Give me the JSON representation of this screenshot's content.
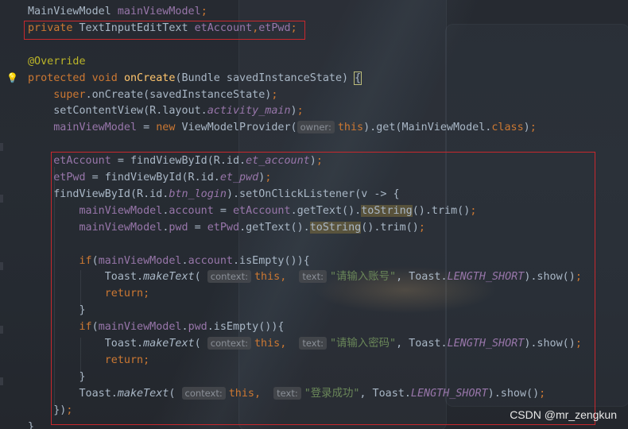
{
  "code_lines": [
    [
      {
        "t": "MainViewModel ",
        "c": "plain"
      },
      {
        "t": "mainViewModel",
        "c": "fld"
      },
      {
        "t": ";",
        "c": "kw"
      }
    ],
    [
      {
        "t": "private ",
        "c": "kw"
      },
      {
        "t": "TextInputEditText ",
        "c": "plain"
      },
      {
        "t": "etAccount",
        "c": "fld"
      },
      {
        "t": ",",
        "c": "kw"
      },
      {
        "t": "etPwd",
        "c": "fld"
      },
      {
        "t": ";",
        "c": "kw"
      }
    ],
    [],
    [
      {
        "t": "@Override",
        "c": "ann"
      }
    ],
    [
      {
        "t": "protected void ",
        "c": "kw"
      },
      {
        "t": "onCreate",
        "c": "fn"
      },
      {
        "t": "(Bundle savedInstanceState) ",
        "c": "plain"
      },
      {
        "t": "{",
        "c": "plain brace-hl"
      }
    ],
    [
      {
        "t": "    "
      },
      {
        "t": "super",
        "c": "kw"
      },
      {
        "t": ".onCreate(savedInstanceState)",
        "c": "plain"
      },
      {
        "t": ";",
        "c": "kw"
      }
    ],
    [
      {
        "t": "    "
      },
      {
        "t": "setContentView(R.layout.",
        "c": "plain"
      },
      {
        "t": "activity_main",
        "c": "italfld"
      },
      {
        "t": ")",
        "c": "plain"
      },
      {
        "t": ";",
        "c": "kw"
      }
    ],
    [
      {
        "t": "    "
      },
      {
        "t": "mainViewModel",
        "c": "fld"
      },
      {
        "t": " = ",
        "c": "plain"
      },
      {
        "t": "new ",
        "c": "kw"
      },
      {
        "t": "ViewModelProvider(",
        "c": "plain"
      },
      {
        "t": "owner:",
        "c": "hint"
      },
      {
        "t": "this",
        "c": "kw"
      },
      {
        "t": ").get(MainViewModel.",
        "c": "plain"
      },
      {
        "t": "class",
        "c": "kw"
      },
      {
        "t": ")",
        "c": "plain"
      },
      {
        "t": ";",
        "c": "kw"
      }
    ],
    [],
    [
      {
        "t": "    "
      },
      {
        "t": "etAccount",
        "c": "fld"
      },
      {
        "t": " = findViewById(R.id.",
        "c": "plain"
      },
      {
        "t": "et_account",
        "c": "italfld"
      },
      {
        "t": ")",
        "c": "plain"
      },
      {
        "t": ";",
        "c": "kw"
      }
    ],
    [
      {
        "t": "    "
      },
      {
        "t": "etPwd",
        "c": "fld"
      },
      {
        "t": " = findViewById(R.id.",
        "c": "plain"
      },
      {
        "t": "et_pwd",
        "c": "italfld"
      },
      {
        "t": ")",
        "c": "plain"
      },
      {
        "t": ";",
        "c": "kw"
      }
    ],
    [
      {
        "t": "    "
      },
      {
        "t": "findViewById(R.id.",
        "c": "plain"
      },
      {
        "t": "btn_login",
        "c": "italfld"
      },
      {
        "t": ").setOnClickListener(v -> {",
        "c": "plain"
      }
    ],
    [
      {
        "t": "        "
      },
      {
        "t": "mainViewModel",
        "c": "fld"
      },
      {
        "t": ".",
        "c": "plain"
      },
      {
        "t": "account",
        "c": "fld"
      },
      {
        "t": " = ",
        "c": "plain"
      },
      {
        "t": "etAccount",
        "c": "fld"
      },
      {
        "t": ".getText().",
        "c": "plain"
      },
      {
        "t": "toString",
        "c": "plain hlbg"
      },
      {
        "t": "().trim()",
        "c": "plain"
      },
      {
        "t": ";",
        "c": "kw"
      }
    ],
    [
      {
        "t": "        "
      },
      {
        "t": "mainViewModel",
        "c": "fld"
      },
      {
        "t": ".",
        "c": "plain"
      },
      {
        "t": "pwd",
        "c": "fld"
      },
      {
        "t": " = ",
        "c": "plain"
      },
      {
        "t": "etPwd",
        "c": "fld"
      },
      {
        "t": ".getText().",
        "c": "plain"
      },
      {
        "t": "toString",
        "c": "plain hlbg"
      },
      {
        "t": "().trim()",
        "c": "plain"
      },
      {
        "t": ";",
        "c": "kw"
      }
    ],
    [],
    [
      {
        "t": "        "
      },
      {
        "t": "if",
        "c": "kw"
      },
      {
        "t": "(",
        "c": "plain"
      },
      {
        "t": "mainViewModel",
        "c": "fld"
      },
      {
        "t": ".",
        "c": "plain"
      },
      {
        "t": "account",
        "c": "fld"
      },
      {
        "t": ".isEmpty()){",
        "c": "plain"
      }
    ],
    [
      {
        "t": "            "
      },
      {
        "t": "Toast.",
        "c": "plain"
      },
      {
        "t": "makeText",
        "c": "plain ital"
      },
      {
        "t": "( ",
        "c": "plain"
      },
      {
        "t": "context:",
        "c": "hint"
      },
      {
        "t": "this",
        "c": "kw"
      },
      {
        "t": ",  ",
        "c": "kw"
      },
      {
        "t": "text:",
        "c": "hint"
      },
      {
        "t": "\"请输入账号\"",
        "c": "str"
      },
      {
        "t": ", Toast.",
        "c": "plain"
      },
      {
        "t": "LENGTH_SHORT",
        "c": "italfld"
      },
      {
        "t": ").show()",
        "c": "plain"
      },
      {
        "t": ";",
        "c": "kw"
      }
    ],
    [
      {
        "t": "            "
      },
      {
        "t": "return;",
        "c": "kw"
      }
    ],
    [
      {
        "t": "        "
      },
      {
        "t": "}",
        "c": "plain"
      }
    ],
    [
      {
        "t": "        "
      },
      {
        "t": "if",
        "c": "kw"
      },
      {
        "t": "(",
        "c": "plain"
      },
      {
        "t": "mainViewModel",
        "c": "fld"
      },
      {
        "t": ".",
        "c": "plain"
      },
      {
        "t": "pwd",
        "c": "fld"
      },
      {
        "t": ".isEmpty()){",
        "c": "plain"
      }
    ],
    [
      {
        "t": "            "
      },
      {
        "t": "Toast.",
        "c": "plain"
      },
      {
        "t": "makeText",
        "c": "plain ital"
      },
      {
        "t": "( ",
        "c": "plain"
      },
      {
        "t": "context:",
        "c": "hint"
      },
      {
        "t": "this",
        "c": "kw"
      },
      {
        "t": ",  ",
        "c": "kw"
      },
      {
        "t": "text:",
        "c": "hint"
      },
      {
        "t": "\"请输入密码\"",
        "c": "str"
      },
      {
        "t": ", Toast.",
        "c": "plain"
      },
      {
        "t": "LENGTH_SHORT",
        "c": "italfld"
      },
      {
        "t": ").show()",
        "c": "plain"
      },
      {
        "t": ";",
        "c": "kw"
      }
    ],
    [
      {
        "t": "            "
      },
      {
        "t": "return;",
        "c": "kw"
      }
    ],
    [
      {
        "t": "        "
      },
      {
        "t": "}",
        "c": "plain"
      }
    ],
    [
      {
        "t": "        "
      },
      {
        "t": "Toast.",
        "c": "plain"
      },
      {
        "t": "makeText",
        "c": "plain ital"
      },
      {
        "t": "( ",
        "c": "plain"
      },
      {
        "t": "context:",
        "c": "hint"
      },
      {
        "t": "this",
        "c": "kw"
      },
      {
        "t": ",  ",
        "c": "kw"
      },
      {
        "t": "text:",
        "c": "hint"
      },
      {
        "t": "\"登录成功\"",
        "c": "str"
      },
      {
        "t": ", Toast.",
        "c": "plain"
      },
      {
        "t": "LENGTH_SHORT",
        "c": "italfld"
      },
      {
        "t": ").show()",
        "c": "plain"
      },
      {
        "t": ";",
        "c": "kw"
      }
    ],
    [
      {
        "t": "    "
      },
      {
        "t": "})",
        "c": "plain"
      },
      {
        "t": ";",
        "c": "kw"
      }
    ],
    [
      {
        "t": "}",
        "c": "plain"
      }
    ]
  ],
  "watermark": "CSDN @mr_zengkun",
  "colors": {
    "keyword": "#cc7832",
    "field": "#9876aa",
    "method_decl": "#ffc66d",
    "annotation": "#bbb529",
    "string": "#6a8759",
    "plain": "#a9b7c6",
    "highlight_box": "#c8282d"
  },
  "icons": [
    "intention-bulb-icon"
  ]
}
